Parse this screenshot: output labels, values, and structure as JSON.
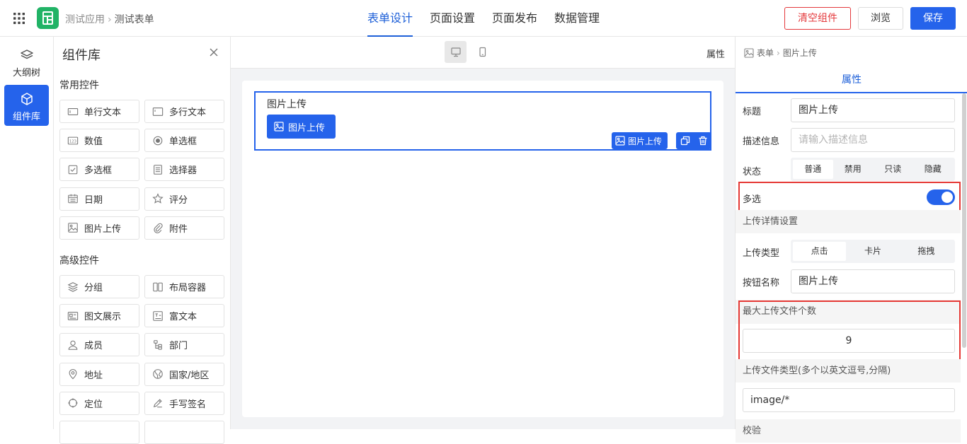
{
  "app": {
    "breadcrumb": [
      "测试应用",
      "测试表单"
    ]
  },
  "nav": {
    "tabs": [
      "表单设计",
      "页面设置",
      "页面发布",
      "数据管理"
    ],
    "active": 0
  },
  "actions": {
    "clear": "清空组件",
    "preview": "浏览",
    "save": "保存"
  },
  "left_sidebar": {
    "items": [
      {
        "label": "大纲树",
        "icon": "layers-icon"
      },
      {
        "label": "组件库",
        "icon": "cube-icon"
      }
    ]
  },
  "component_library": {
    "title": "组件库",
    "sections": [
      {
        "title": "常用控件",
        "items": [
          {
            "label": "单行文本",
            "icon": "single-line-text-icon"
          },
          {
            "label": "多行文本",
            "icon": "multi-line-text-icon"
          },
          {
            "label": "数值",
            "icon": "number-icon"
          },
          {
            "label": "单选框",
            "icon": "radio-icon"
          },
          {
            "label": "多选框",
            "icon": "checkbox-icon"
          },
          {
            "label": "选择器",
            "icon": "select-icon"
          },
          {
            "label": "日期",
            "icon": "calendar-icon"
          },
          {
            "label": "评分",
            "icon": "star-icon"
          },
          {
            "label": "图片上传",
            "icon": "image-icon"
          },
          {
            "label": "附件",
            "icon": "paperclip-icon"
          }
        ]
      },
      {
        "title": "高级控件",
        "items": [
          {
            "label": "分组",
            "icon": "group-icon"
          },
          {
            "label": "布局容器",
            "icon": "layout-icon"
          },
          {
            "label": "图文展示",
            "icon": "image-text-icon"
          },
          {
            "label": "富文本",
            "icon": "rich-text-icon"
          },
          {
            "label": "成员",
            "icon": "user-icon"
          },
          {
            "label": "部门",
            "icon": "department-icon"
          },
          {
            "label": "地址",
            "icon": "location-icon"
          },
          {
            "label": "国家/地区",
            "icon": "globe-icon"
          },
          {
            "label": "定位",
            "icon": "crosshair-icon"
          },
          {
            "label": "手写签名",
            "icon": "pen-icon"
          }
        ]
      }
    ]
  },
  "canvas": {
    "attr_label": "属性",
    "field": {
      "label": "图片上传",
      "button_label": "图片上传",
      "type_tag": "图片上传"
    }
  },
  "properties": {
    "breadcrumb": [
      "表单",
      "图片上传"
    ],
    "tab": "属性",
    "title": {
      "label": "标题",
      "value": "图片上传"
    },
    "description": {
      "label": "描述信息",
      "placeholder": "请输入描述信息"
    },
    "state": {
      "label": "状态",
      "options": [
        "普通",
        "禁用",
        "只读",
        "隐藏"
      ],
      "selected": "普通"
    },
    "multiple": {
      "label": "多选",
      "value": true
    },
    "upload_section": "上传详情设置",
    "upload_type": {
      "label": "上传类型",
      "options": [
        "点击",
        "卡片",
        "拖拽"
      ],
      "selected": "点击"
    },
    "button_name": {
      "label": "按钮名称",
      "value": "图片上传"
    },
    "max_files": {
      "label": "最大上传文件个数",
      "value": "9"
    },
    "file_types": {
      "label": "上传文件类型(多个以英文逗号,分隔)",
      "value": "image/*"
    },
    "validation": {
      "label": "校验"
    }
  },
  "colors": {
    "primary": "#2563eb",
    "danger": "#e53935",
    "logo": "#21b366"
  }
}
